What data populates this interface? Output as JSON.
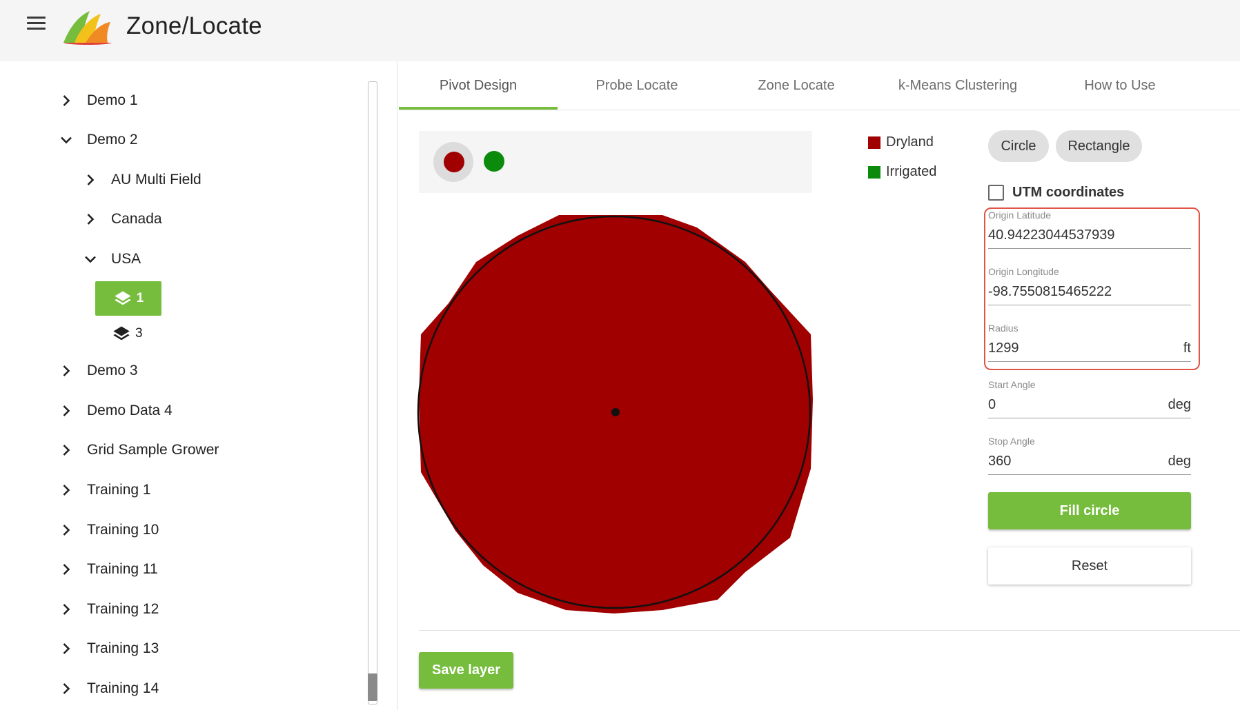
{
  "app": {
    "title": "Zone/Locate"
  },
  "header": {
    "menu_icon": "hamburger-menu-icon",
    "logo": "zone-locate-logo"
  },
  "sidebar": {
    "items": [
      {
        "label": "Demo 1",
        "expanded": false
      },
      {
        "label": "Demo 2",
        "expanded": true
      },
      {
        "label": "AU Multi Field",
        "expanded": false
      },
      {
        "label": "Canada",
        "expanded": false
      },
      {
        "label": "USA",
        "expanded": true
      },
      {
        "label": "Demo 3",
        "expanded": false
      },
      {
        "label": "Demo Data 4",
        "expanded": false
      },
      {
        "label": "Grid Sample Grower",
        "expanded": false
      },
      {
        "label": "Training 1",
        "expanded": false
      },
      {
        "label": "Training 10",
        "expanded": false
      },
      {
        "label": "Training 11",
        "expanded": false
      },
      {
        "label": "Training 12",
        "expanded": false
      },
      {
        "label": "Training 13",
        "expanded": false
      },
      {
        "label": "Training 14",
        "expanded": false
      }
    ],
    "layers": [
      {
        "label": "1",
        "active": true,
        "icon": "layers-icon"
      },
      {
        "label": "3",
        "active": false,
        "icon": "layers-icon"
      }
    ]
  },
  "tabs": [
    {
      "label": "Pivot Design",
      "active": true
    },
    {
      "label": "Probe Locate",
      "active": false
    },
    {
      "label": "Zone Locate",
      "active": false
    },
    {
      "label": "k-Means Clustering",
      "active": false
    },
    {
      "label": "How to Use",
      "active": false
    }
  ],
  "palette": {
    "swatches": [
      {
        "name": "Dryland",
        "color": "#a00000",
        "selected": true
      },
      {
        "name": "Irrigated",
        "color": "#0b8a0b",
        "selected": false
      }
    ]
  },
  "legend": [
    {
      "label": "Dryland",
      "color": "#a00000"
    },
    {
      "label": "Irrigated",
      "color": "#0b8a0b"
    }
  ],
  "shape": {
    "circle_label": "Circle",
    "rectangle_label": "Rectangle"
  },
  "utm": {
    "label": "UTM coordinates",
    "checked": false
  },
  "fields": {
    "origin_latitude": {
      "label": "Origin Latitude",
      "value": "40.94223044537939"
    },
    "origin_longitude": {
      "label": "Origin Longitude",
      "value": "-98.7550815465222"
    },
    "radius": {
      "label": "Radius",
      "value": "1299",
      "unit": "ft"
    },
    "start_angle": {
      "label": "Start Angle",
      "value": "0",
      "unit": "deg"
    },
    "stop_angle": {
      "label": "Stop Angle",
      "value": "360",
      "unit": "deg"
    }
  },
  "actions": {
    "fill_circle": "Fill circle",
    "reset": "Reset",
    "save_layer": "Save layer"
  }
}
